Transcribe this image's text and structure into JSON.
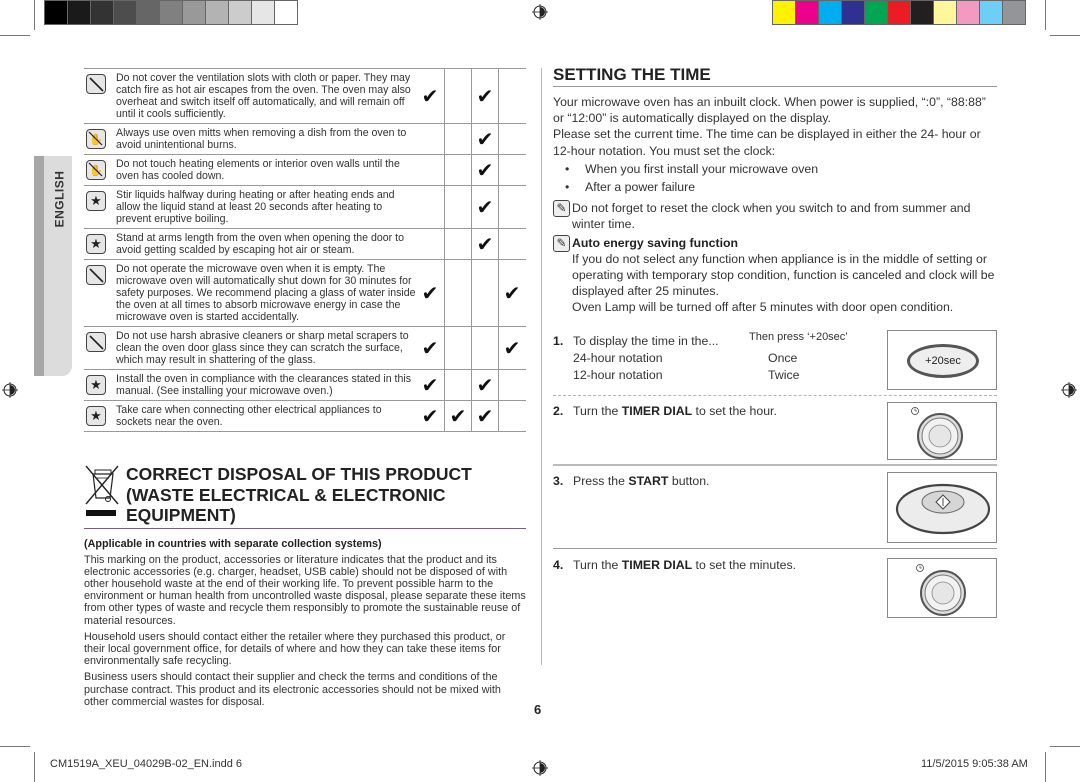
{
  "print_marks": {
    "gray_swatches": [
      "#000000",
      "#1a1a1a",
      "#333333",
      "#4d4d4d",
      "#666666",
      "#808080",
      "#999999",
      "#b3b3b3",
      "#cccccc",
      "#e6e6e6",
      "#ffffff"
    ],
    "color_swatches": [
      "#fff200",
      "#ec008c",
      "#00aeef",
      "#2e3192",
      "#00a651",
      "#ed1c24",
      "#231f20",
      "#fff799",
      "#f49ac1",
      "#6dcff6",
      "#939598"
    ]
  },
  "sidebar": {
    "language_tab": "ENGLISH"
  },
  "safety_table": {
    "rows": [
      {
        "icon": "prohibited-icon",
        "text": "Do not cover the ventilation slots with cloth or paper. They may catch fire as hot air escapes from the oven. The oven may also overheat and switch itself off automatically, and will remain off until it cools sufficiently.",
        "checks": [
          "✔",
          "",
          "✔",
          ""
        ]
      },
      {
        "icon": "no-touch-icon",
        "text": "Always use oven mitts when removing a dish from the oven to avoid unintentional burns.",
        "checks": [
          "",
          "",
          "✔",
          ""
        ]
      },
      {
        "icon": "no-touch-icon",
        "text": "Do not touch heating elements or interior oven walls until the oven has cooled down.",
        "checks": [
          "",
          "",
          "✔",
          ""
        ]
      },
      {
        "icon": "star-icon",
        "text": "Stir liquids halfway during heating or after heating ends and allow the liquid stand at least 20 seconds after heating to prevent eruptive boiling.",
        "checks": [
          "",
          "",
          "✔",
          ""
        ]
      },
      {
        "icon": "star-icon",
        "text": "Stand at arms length from the oven when opening the door to avoid getting scalded by escaping hot air or steam.",
        "checks": [
          "",
          "",
          "✔",
          ""
        ]
      },
      {
        "icon": "prohibited-icon",
        "text": "Do not operate the microwave oven when it is empty. The microwave oven will automatically shut down for 30 minutes for safety purposes. We recommend placing a glass of water inside the oven at all times to absorb microwave energy in case the microwave oven is started accidentally.",
        "checks": [
          "✔",
          "",
          "",
          "✔"
        ]
      },
      {
        "icon": "prohibited-icon",
        "text": "Do not use harsh abrasive cleaners or sharp metal scrapers to clean the oven door glass since they can scratch the surface, which may result in shattering of the glass.",
        "checks": [
          "✔",
          "",
          "",
          "✔"
        ]
      },
      {
        "icon": "star-icon",
        "text": "Install the oven in compliance with the clearances stated in this manual. (See installing your microwave oven.)",
        "checks": [
          "✔",
          "",
          "✔",
          ""
        ]
      },
      {
        "icon": "star-icon",
        "text": "Take care when connecting other electrical appliances to sockets near the oven.",
        "checks": [
          "✔",
          "✔",
          "✔",
          ""
        ]
      }
    ]
  },
  "weee": {
    "title": "CORRECT DISPOSAL OF THIS PRODUCT (WASTE ELECTRICAL & ELECTRONIC EQUIPMENT)",
    "title_lines": [
      "CORRECT DISPOSAL OF THIS PRODUCT",
      "(WASTE ELECTRICAL & ELECTRONIC",
      "EQUIPMENT)"
    ],
    "subtitle": "(Applicable in countries with separate collection systems)",
    "paragraphs": [
      "This marking on the product, accessories or literature indicates that the product and its electronic accessories (e.g. charger, headset, USB cable) should not be disposed of with other household waste at the end of their working life. To prevent possible harm to the environment or human health from uncontrolled waste disposal, please separate these items from other types of waste and recycle them responsibly to promote the sustainable reuse of material resources.",
      "Household users should contact either the retailer where they purchased this product, or their local government office, for details of where and how they can take these items for environmentally safe recycling.",
      "Business users should contact their supplier and check the terms and conditions of the purchase contract. This product and its electronic accessories should not be mixed with other commercial wastes for disposal."
    ]
  },
  "setting_time": {
    "title": "SETTING THE TIME",
    "intro_1": "Your microwave oven has an inbuilt clock. When power is supplied, “:0”, “88:88” or “12:00” is automatically displayed on the display.",
    "intro_2": "Please set the current time. The time can be displayed in either the 24- hour or 12-hour notation. You must set the clock:",
    "bullets": [
      "When you first install your microwave oven",
      "After a power failure"
    ],
    "note_1": "Do not forget to reset the clock when you switch to and from summer and winter time.",
    "note_2_title": "Auto energy saving function",
    "note_2_p1": "If you do not select any function when appliance is in the middle of setting or operating with temporary stop condition, function is canceled and clock will be displayed after 25 minutes.",
    "note_2_p2": "Oven Lamp will be turned off after 5 minutes with door open condition.",
    "steps": [
      {
        "num": "1.",
        "text": "To display the time in the...",
        "then": "Then press ‘+20sec’",
        "rows": [
          {
            "label": "24-hour notation",
            "value": "Once"
          },
          {
            "label": "12-hour notation",
            "value": "Twice"
          }
        ],
        "figure": "+20sec"
      },
      {
        "num": "2.",
        "pre": "Turn the ",
        "bold": "TIMER DIAL",
        "post": " to set the hour."
      },
      {
        "num": "3.",
        "pre": "Press the ",
        "bold": "START",
        "post": " button."
      },
      {
        "num": "4.",
        "pre": "Turn the ",
        "bold": "TIMER DIAL",
        "post": " to set the minutes."
      }
    ]
  },
  "page_number": "6",
  "footer": {
    "file": "CM1519A_XEU_04029B-02_EN.indd   6",
    "datetime": "11/5/2015   9:05:38 AM"
  }
}
